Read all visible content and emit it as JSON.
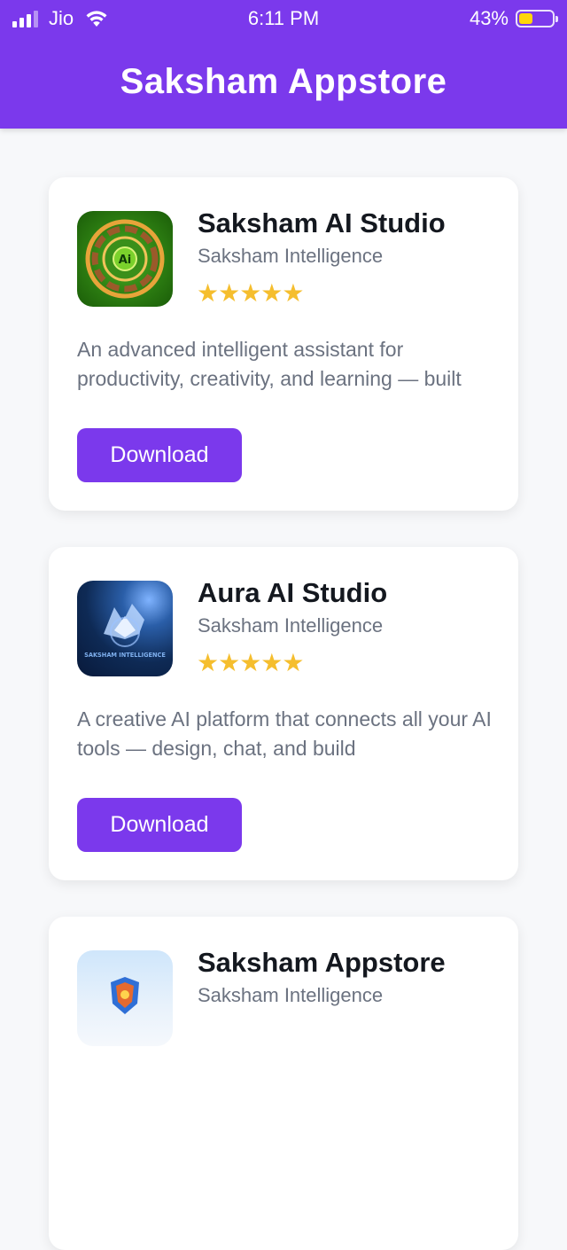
{
  "status": {
    "carrier": "Jio",
    "time": "6:11 PM",
    "battery": "43%",
    "battery_level": 0.43
  },
  "header": {
    "title": "Saksham Appstore"
  },
  "apps": [
    {
      "name": "Saksham AI Studio",
      "developer": "Saksham Intelligence",
      "stars": "★★★★★",
      "rating": 5,
      "description": "An advanced intelligent assistant for productivity, creativity, and learning — built",
      "button": "Download",
      "icon": "ai-studio-icon"
    },
    {
      "name": "Aura AI Studio",
      "developer": "Saksham Intelligence",
      "stars": "★★★★★",
      "rating": 5,
      "description": "A creative AI platform that connects all your AI tools — design, chat, and build",
      "button": "Download",
      "icon": "saksham-intelligence-eagle-icon",
      "icon_text": "SAKSHAM INTELLIGENCE"
    },
    {
      "name": "Saksham Appstore",
      "developer": "Saksham Intelligence",
      "icon": "appstore-shield-icon"
    }
  ],
  "colors": {
    "accent": "#7b39ec",
    "star": "#f5be2e",
    "background": "#f7f8fa"
  }
}
